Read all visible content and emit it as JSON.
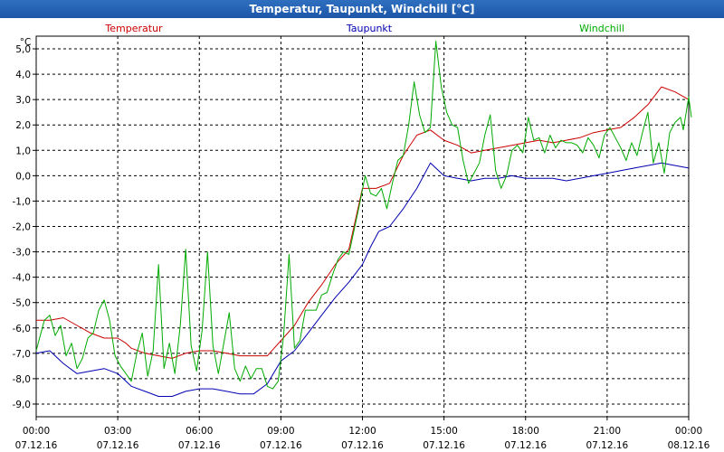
{
  "window": {
    "title": "Temperatur, Taupunkt, Windchill [°C]"
  },
  "colors": {
    "temperatur": "#cc0000",
    "taupunkt": "#0000b0",
    "windchill": "#00aa00",
    "grid": "#000000",
    "background": "#ffffff"
  },
  "chart_data": {
    "type": "line",
    "y_unit": "°C",
    "ylim": [
      -9.5,
      5.5
    ],
    "xlim": [
      "07.12.16 00:00",
      "08.12.16 00:00"
    ],
    "grid": true,
    "legend_placement": "top",
    "y_ticks": [
      {
        "value": 5,
        "label": "5,0"
      },
      {
        "value": 4,
        "label": "4,0"
      },
      {
        "value": 3,
        "label": "3,0"
      },
      {
        "value": 2,
        "label": "2,0"
      },
      {
        "value": 1,
        "label": "1,0"
      },
      {
        "value": 0,
        "label": "0,0"
      },
      {
        "value": -1,
        "label": "-1,0"
      },
      {
        "value": -2,
        "label": "-2,0"
      },
      {
        "value": -3,
        "label": "-3,0"
      },
      {
        "value": -4,
        "label": "-4,0"
      },
      {
        "value": -5,
        "label": "-5,0"
      },
      {
        "value": -6,
        "label": "-6,0"
      },
      {
        "value": -7,
        "label": "-7,0"
      },
      {
        "value": -8,
        "label": "-8,0"
      },
      {
        "value": -9,
        "label": "-9,0"
      }
    ],
    "x_ticks": [
      {
        "hour": 0,
        "time": "00:00",
        "date": "07.12.16"
      },
      {
        "hour": 3,
        "time": "03:00",
        "date": "07.12.16"
      },
      {
        "hour": 6,
        "time": "06:00",
        "date": "07.12.16"
      },
      {
        "hour": 9,
        "time": "09:00",
        "date": "07.12.16"
      },
      {
        "hour": 12,
        "time": "12:00",
        "date": "07.12.16"
      },
      {
        "hour": 15,
        "time": "15:00",
        "date": "07.12.16"
      },
      {
        "hour": 18,
        "time": "18:00",
        "date": "07.12.16"
      },
      {
        "hour": 21,
        "time": "21:00",
        "date": "07.12.16"
      },
      {
        "hour": 24,
        "time": "00:00",
        "date": "08.12.16"
      }
    ],
    "series": [
      {
        "key": "temperatur",
        "name": "Temperatur",
        "points": [
          [
            0,
            -5.7
          ],
          [
            0.5,
            -5.7
          ],
          [
            1,
            -5.6
          ],
          [
            1.5,
            -5.9
          ],
          [
            2,
            -6.2
          ],
          [
            2.5,
            -6.4
          ],
          [
            3,
            -6.4
          ],
          [
            3.3,
            -6.6
          ],
          [
            3.5,
            -6.8
          ],
          [
            4,
            -7.0
          ],
          [
            4.5,
            -7.1
          ],
          [
            5,
            -7.2
          ],
          [
            5.5,
            -7.0
          ],
          [
            6,
            -6.9
          ],
          [
            6.5,
            -6.9
          ],
          [
            7,
            -7.0
          ],
          [
            7.5,
            -7.1
          ],
          [
            8,
            -7.1
          ],
          [
            8.5,
            -7.1
          ],
          [
            9,
            -6.5
          ],
          [
            9.5,
            -5.9
          ],
          [
            10,
            -5.0
          ],
          [
            10.5,
            -4.3
          ],
          [
            11,
            -3.5
          ],
          [
            11.5,
            -2.9
          ],
          [
            12,
            -0.5
          ],
          [
            12.5,
            -0.5
          ],
          [
            13,
            -0.3
          ],
          [
            13.5,
            0.8
          ],
          [
            14,
            1.6
          ],
          [
            14.5,
            1.8
          ],
          [
            15,
            1.4
          ],
          [
            15.5,
            1.2
          ],
          [
            16,
            0.9
          ],
          [
            16.5,
            1.0
          ],
          [
            17,
            1.1
          ],
          [
            17.5,
            1.2
          ],
          [
            18,
            1.3
          ],
          [
            18.5,
            1.4
          ],
          [
            19,
            1.3
          ],
          [
            19.5,
            1.4
          ],
          [
            20,
            1.5
          ],
          [
            20.5,
            1.7
          ],
          [
            21,
            1.8
          ],
          [
            21.5,
            1.9
          ],
          [
            22,
            2.3
          ],
          [
            22.5,
            2.8
          ],
          [
            23,
            3.5
          ],
          [
            23.5,
            3.3
          ],
          [
            24,
            3.0
          ]
        ]
      },
      {
        "key": "taupunkt",
        "name": "Taupunkt",
        "points": [
          [
            0,
            -7.0
          ],
          [
            0.5,
            -6.9
          ],
          [
            1,
            -7.4
          ],
          [
            1.5,
            -7.8
          ],
          [
            2,
            -7.7
          ],
          [
            2.5,
            -7.6
          ],
          [
            3,
            -7.8
          ],
          [
            3.5,
            -8.3
          ],
          [
            4,
            -8.5
          ],
          [
            4.5,
            -8.7
          ],
          [
            5,
            -8.7
          ],
          [
            5.5,
            -8.5
          ],
          [
            6,
            -8.4
          ],
          [
            6.5,
            -8.4
          ],
          [
            7,
            -8.5
          ],
          [
            7.5,
            -8.6
          ],
          [
            8,
            -8.6
          ],
          [
            8.5,
            -8.2
          ],
          [
            9,
            -7.3
          ],
          [
            9.5,
            -6.9
          ],
          [
            10,
            -6.2
          ],
          [
            10.5,
            -5.5
          ],
          [
            11,
            -4.8
          ],
          [
            11.5,
            -4.2
          ],
          [
            12,
            -3.5
          ],
          [
            12.3,
            -2.8
          ],
          [
            12.6,
            -2.2
          ],
          [
            13,
            -2.0
          ],
          [
            13.5,
            -1.3
          ],
          [
            14,
            -0.5
          ],
          [
            14.5,
            0.5
          ],
          [
            15,
            0.0
          ],
          [
            15.5,
            -0.1
          ],
          [
            16,
            -0.2
          ],
          [
            16.5,
            -0.1
          ],
          [
            17,
            -0.1
          ],
          [
            17.5,
            0.0
          ],
          [
            18,
            -0.1
          ],
          [
            18.5,
            -0.1
          ],
          [
            19,
            -0.1
          ],
          [
            19.5,
            -0.2
          ],
          [
            20,
            -0.1
          ],
          [
            20.5,
            0.0
          ],
          [
            21,
            0.1
          ],
          [
            21.5,
            0.2
          ],
          [
            22,
            0.3
          ],
          [
            22.5,
            0.4
          ],
          [
            23,
            0.5
          ],
          [
            23.5,
            0.4
          ],
          [
            24,
            0.3
          ]
        ]
      },
      {
        "key": "windchill",
        "name": "Windchill",
        "points": [
          [
            0,
            -6.9
          ],
          [
            0.3,
            -5.7
          ],
          [
            0.5,
            -5.5
          ],
          [
            0.7,
            -6.3
          ],
          [
            0.9,
            -5.9
          ],
          [
            1.1,
            -7.1
          ],
          [
            1.3,
            -6.6
          ],
          [
            1.5,
            -7.6
          ],
          [
            1.7,
            -7.2
          ],
          [
            1.9,
            -6.4
          ],
          [
            2.1,
            -6.2
          ],
          [
            2.3,
            -5.3
          ],
          [
            2.5,
            -4.9
          ],
          [
            2.7,
            -5.7
          ],
          [
            2.9,
            -7.1
          ],
          [
            3.1,
            -7.5
          ],
          [
            3.3,
            -7.8
          ],
          [
            3.5,
            -8.1
          ],
          [
            3.7,
            -7.0
          ],
          [
            3.9,
            -6.2
          ],
          [
            4.1,
            -7.9
          ],
          [
            4.3,
            -6.9
          ],
          [
            4.5,
            -3.5
          ],
          [
            4.7,
            -7.6
          ],
          [
            4.9,
            -6.6
          ],
          [
            5.1,
            -7.8
          ],
          [
            5.3,
            -5.9
          ],
          [
            5.5,
            -2.9
          ],
          [
            5.7,
            -6.7
          ],
          [
            5.9,
            -7.7
          ],
          [
            6.1,
            -6.1
          ],
          [
            6.3,
            -3.0
          ],
          [
            6.5,
            -6.7
          ],
          [
            6.7,
            -7.8
          ],
          [
            6.9,
            -6.6
          ],
          [
            7.1,
            -5.4
          ],
          [
            7.3,
            -7.6
          ],
          [
            7.5,
            -8.1
          ],
          [
            7.7,
            -7.5
          ],
          [
            7.9,
            -8.0
          ],
          [
            8.1,
            -7.6
          ],
          [
            8.3,
            -7.6
          ],
          [
            8.5,
            -8.3
          ],
          [
            8.7,
            -8.4
          ],
          [
            8.9,
            -8.1
          ],
          [
            9.1,
            -6.3
          ],
          [
            9.3,
            -3.1
          ],
          [
            9.5,
            -6.8
          ],
          [
            9.7,
            -6.5
          ],
          [
            9.9,
            -5.3
          ],
          [
            10.1,
            -5.3
          ],
          [
            10.3,
            -5.3
          ],
          [
            10.5,
            -4.7
          ],
          [
            10.7,
            -4.6
          ],
          [
            10.9,
            -3.9
          ],
          [
            11.1,
            -3.3
          ],
          [
            11.3,
            -3.0
          ],
          [
            11.5,
            -3.1
          ],
          [
            11.7,
            -2.1
          ],
          [
            11.9,
            -1.1
          ],
          [
            12.1,
            0.0
          ],
          [
            12.3,
            -0.7
          ],
          [
            12.5,
            -0.8
          ],
          [
            12.7,
            -0.5
          ],
          [
            12.9,
            -1.3
          ],
          [
            13.1,
            -0.3
          ],
          [
            13.3,
            0.6
          ],
          [
            13.5,
            0.8
          ],
          [
            13.7,
            2.0
          ],
          [
            13.9,
            3.7
          ],
          [
            14.1,
            2.4
          ],
          [
            14.3,
            1.7
          ],
          [
            14.5,
            1.9
          ],
          [
            14.7,
            5.3
          ],
          [
            14.9,
            3.5
          ],
          [
            15.1,
            2.5
          ],
          [
            15.3,
            2.0
          ],
          [
            15.5,
            1.9
          ],
          [
            15.7,
            0.6
          ],
          [
            15.9,
            -0.3
          ],
          [
            16.1,
            0.1
          ],
          [
            16.3,
            0.5
          ],
          [
            16.5,
            1.6
          ],
          [
            16.7,
            2.4
          ],
          [
            16.9,
            0.2
          ],
          [
            17.1,
            -0.5
          ],
          [
            17.3,
            0.0
          ],
          [
            17.5,
            1.0
          ],
          [
            17.7,
            1.2
          ],
          [
            17.9,
            0.9
          ],
          [
            18.1,
            2.3
          ],
          [
            18.3,
            1.4
          ],
          [
            18.5,
            1.5
          ],
          [
            18.7,
            0.9
          ],
          [
            18.9,
            1.6
          ],
          [
            19.1,
            1.1
          ],
          [
            19.3,
            1.4
          ],
          [
            19.5,
            1.3
          ],
          [
            19.7,
            1.3
          ],
          [
            19.9,
            1.2
          ],
          [
            20.1,
            0.9
          ],
          [
            20.3,
            1.5
          ],
          [
            20.5,
            1.2
          ],
          [
            20.7,
            0.7
          ],
          [
            20.9,
            1.6
          ],
          [
            21.1,
            1.9
          ],
          [
            21.3,
            1.5
          ],
          [
            21.5,
            1.1
          ],
          [
            21.7,
            0.6
          ],
          [
            21.9,
            1.3
          ],
          [
            22.1,
            0.8
          ],
          [
            22.3,
            1.7
          ],
          [
            22.5,
            2.5
          ],
          [
            22.7,
            0.5
          ],
          [
            22.9,
            1.3
          ],
          [
            23.1,
            0.1
          ],
          [
            23.3,
            1.7
          ],
          [
            23.5,
            2.1
          ],
          [
            23.7,
            2.3
          ],
          [
            23.8,
            1.8
          ],
          [
            24,
            3.1
          ],
          [
            24.1,
            2.3
          ]
        ]
      }
    ]
  }
}
